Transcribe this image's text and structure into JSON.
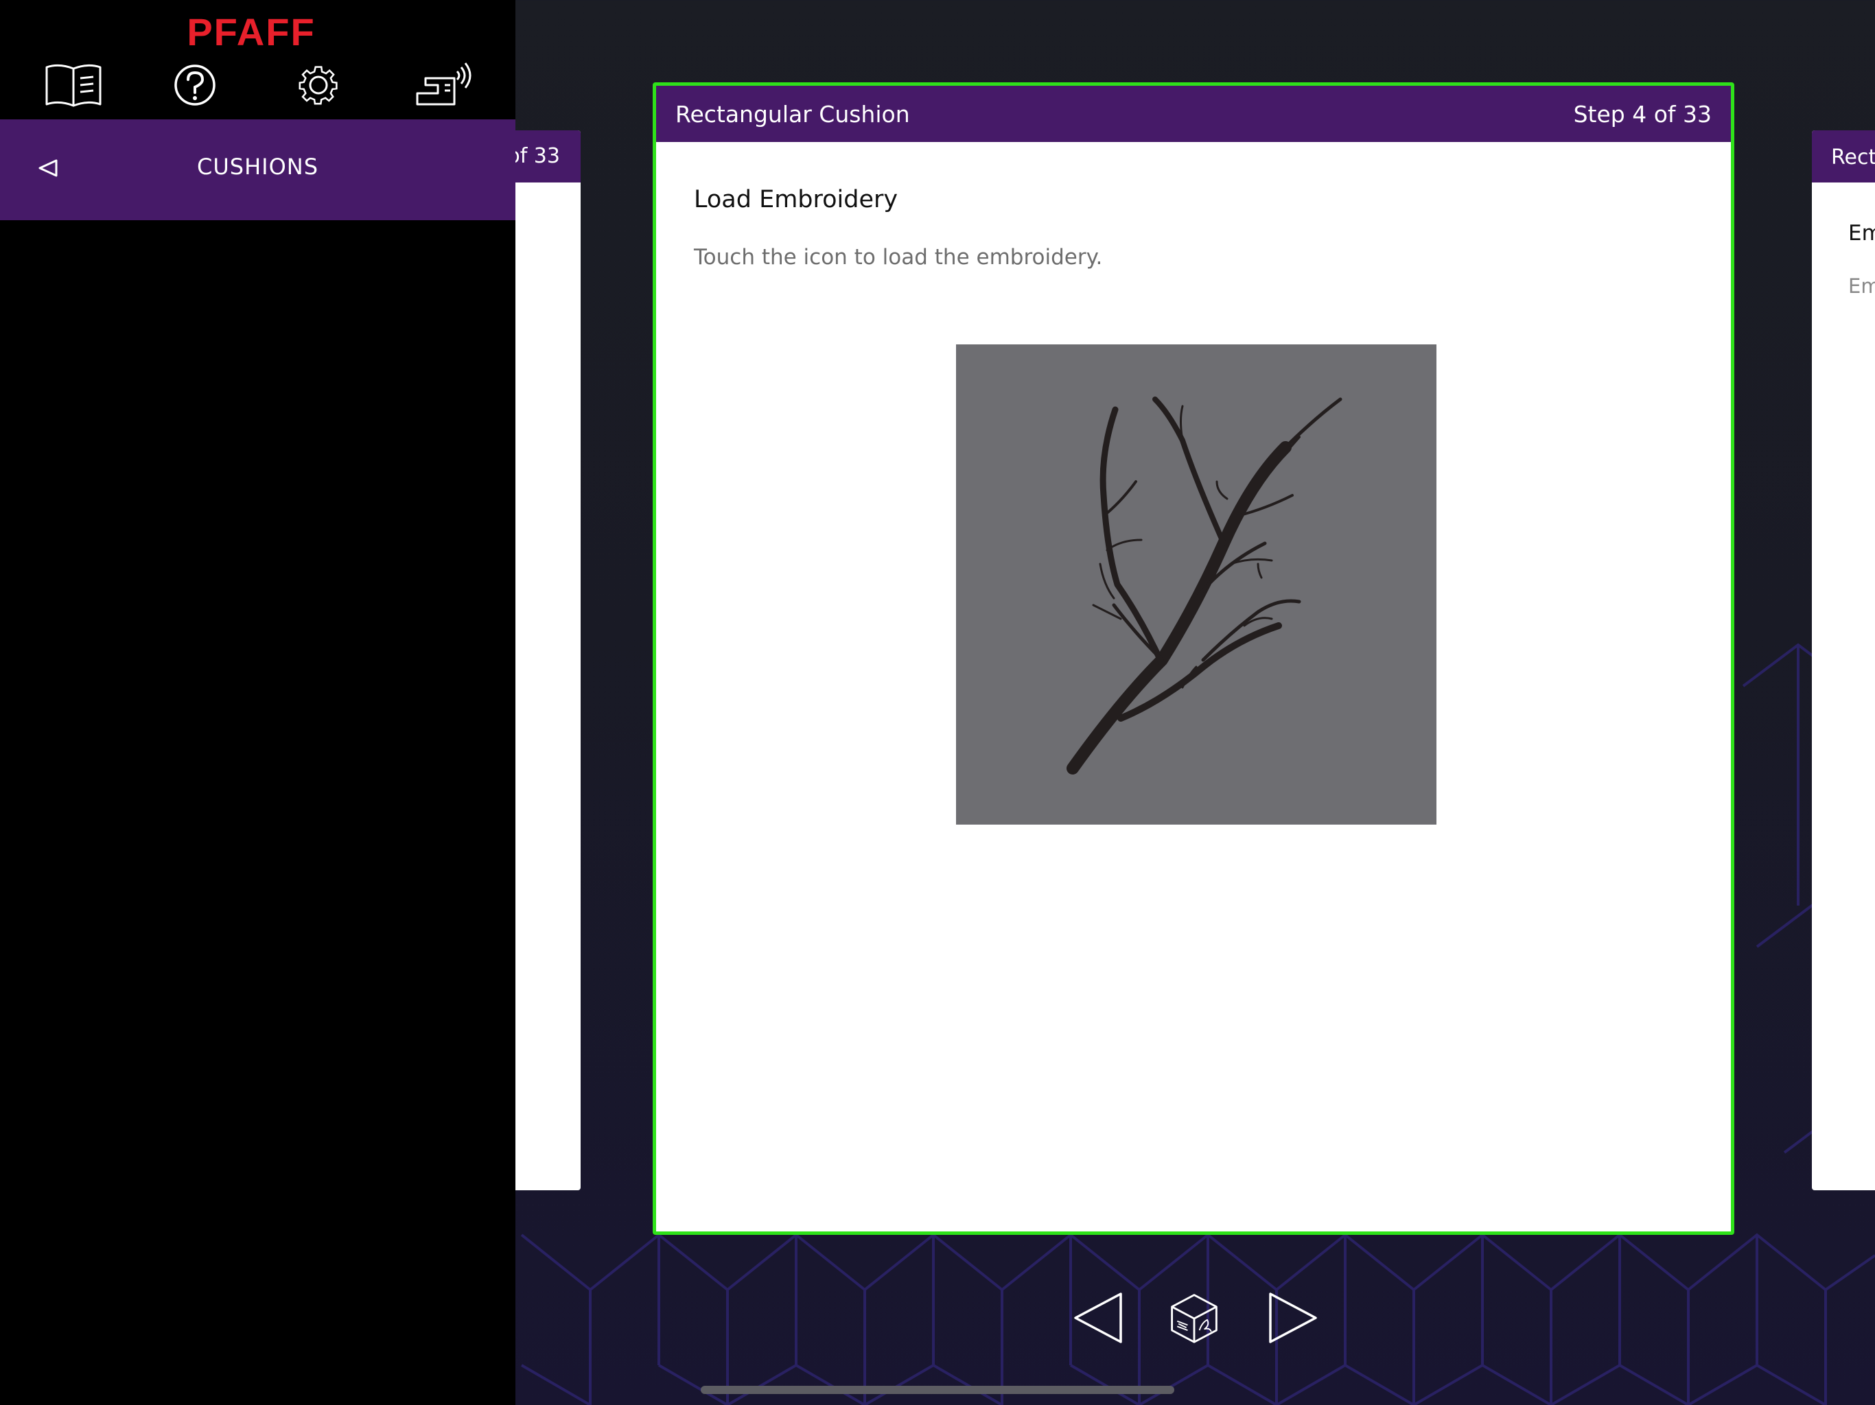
{
  "brand": {
    "name": "PFAFF",
    "color": "#e8202b"
  },
  "toolbar": {
    "buttons": [
      {
        "icon": "book-icon",
        "name": "manual"
      },
      {
        "icon": "help-icon",
        "name": "help"
      },
      {
        "icon": "gear-icon",
        "name": "settings"
      },
      {
        "icon": "sewing-machine-wifi-icon",
        "name": "machine-connection"
      }
    ]
  },
  "sidebar": {
    "section_title": "CUSHIONS",
    "back_icon": "chevron-left-icon"
  },
  "prev_card": {
    "step_text": "of 33"
  },
  "next_card": {
    "title_text": "Recta",
    "heading": "Em",
    "text": "Em"
  },
  "main_card": {
    "title": "Rectangular Cushion",
    "step": "Step 4 of 33",
    "heading": "Load Embroidery",
    "text": "Touch the icon to load the embroidery.",
    "image_icon": "branch-embroidery-icon"
  },
  "bottom_nav": {
    "prev_icon": "triangle-left-icon",
    "center_icon": "embroidery-cube-icon",
    "next_icon": "triangle-right-icon"
  },
  "colors": {
    "accent_purple": "#461a68",
    "highlight_green": "#2fe21a",
    "image_bg": "#6e6e72"
  }
}
